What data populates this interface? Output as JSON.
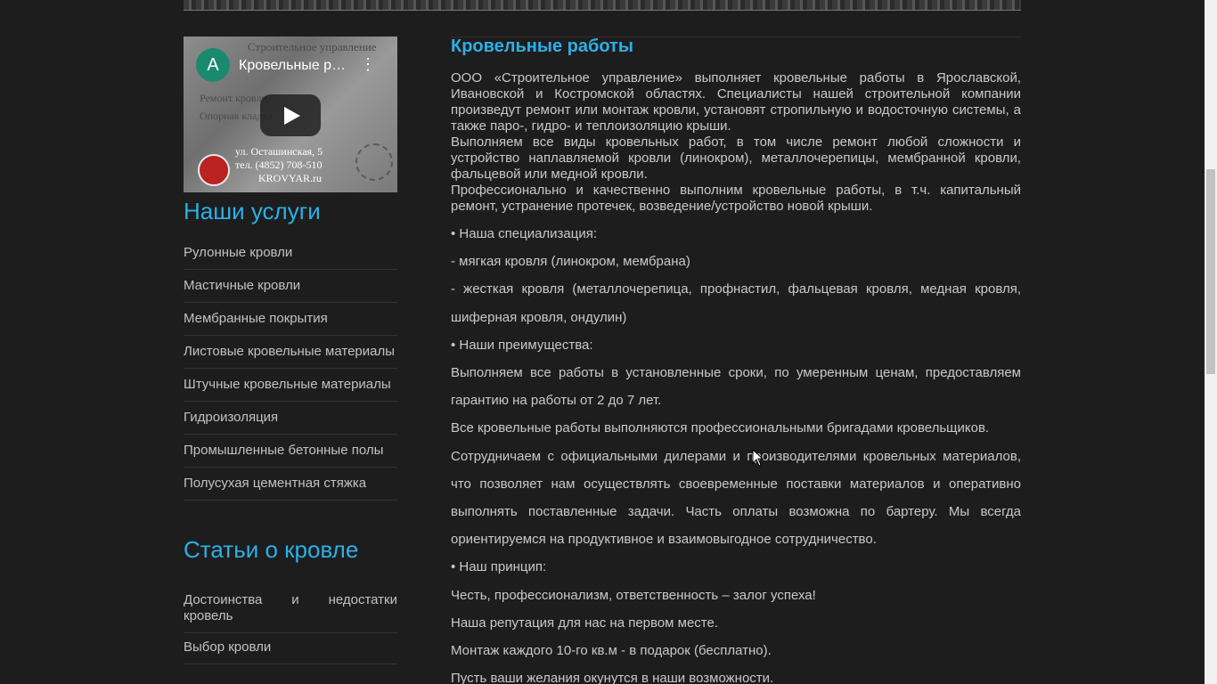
{
  "video": {
    "avatar_letter": "A",
    "title": "Кровельные работы в Ярославле",
    "bg_lines": [
      "Строительное управление",
      "Ремонт кровли",
      "Опорная кладка",
      "ул. Осташинская, 5",
      "тел. (4852) 708-510",
      "KROVYAR.ru"
    ],
    "menu_icon": "more-vert-icon",
    "play_icon": "play-icon"
  },
  "services": {
    "title": "Наши услуги",
    "items": [
      "Рулонные кровли",
      "Мастичные кровли",
      "Мембранные покрытия",
      "Листовые кровельные материалы",
      "Штучные кровельные материалы",
      "Гидроизоляция",
      "Промышленные бетонные полы",
      "Полусухая цементная стяжка"
    ]
  },
  "articles": {
    "title": "Статьи о кровле",
    "items": [
      "Достоинства и недостатки кровель",
      "Выбор кровли"
    ]
  },
  "main": {
    "title": "Кровельные работы",
    "intro": [
      "ООО «Строительное управление» выполняет кровельные работы в Ярославской, Ивановской и Костромской областях. Специалисты нашей строительной компании произведут ремонт или монтаж кровли, установят стропильную и водосточную системы, а также паро-, гидро- и теплоизоляцию крыши.",
      "Выполняем все виды кровельных работ, в том числе ремонт любой сложности и устройство наплавляемой кровли (линокром), металлочерепицы, мембранной кровли, фальцевой или медной кровли.",
      "Профессионально и качественно выполним кровельные работы, в т.ч. капитальный ремонт, устранение протечек, возведение/устройство новой крыши."
    ],
    "lines": [
      "• Наша специализация:",
      "- мягкая кровля (линокром, мембрана)",
      "- жесткая кровля (металлочерепица, профнастил, фальцевая кровля, медная кровля, шиферная кровля, ондулин)",
      "• Наши преимущества:",
      "Выполняем все работы в установленные сроки, по умеренным ценам, предоставляем гарантию на работы от 2 до 7 лет.",
      "Все кровельные работы выполняются профессиональными бригадами кровельщиков.",
      "Сотрудничаем с официальными дилерами и производителями кровельных материалов, что позволяет нам осуществлять своевременные поставки материалов и оперативно выполнять поставленные задачи. Часть оплаты возможна по бартеру. Мы всегда ориентируемся на продуктивное и взаимовыгодное сотрудничество.",
      "• Наш принцип:",
      "Честь, профессионализм, ответственность – залог успеха!",
      "Наша репутация для нас на первом месте.",
      "Монтаж каждого 10-го кв.м - в подарок (бесплатно).",
      "Пусть ваши желания окунутся в наши возможности."
    ]
  },
  "colors": {
    "accent": "#2bb0e8",
    "background": "#1d1d1d",
    "text": "#c9c9c9"
  }
}
